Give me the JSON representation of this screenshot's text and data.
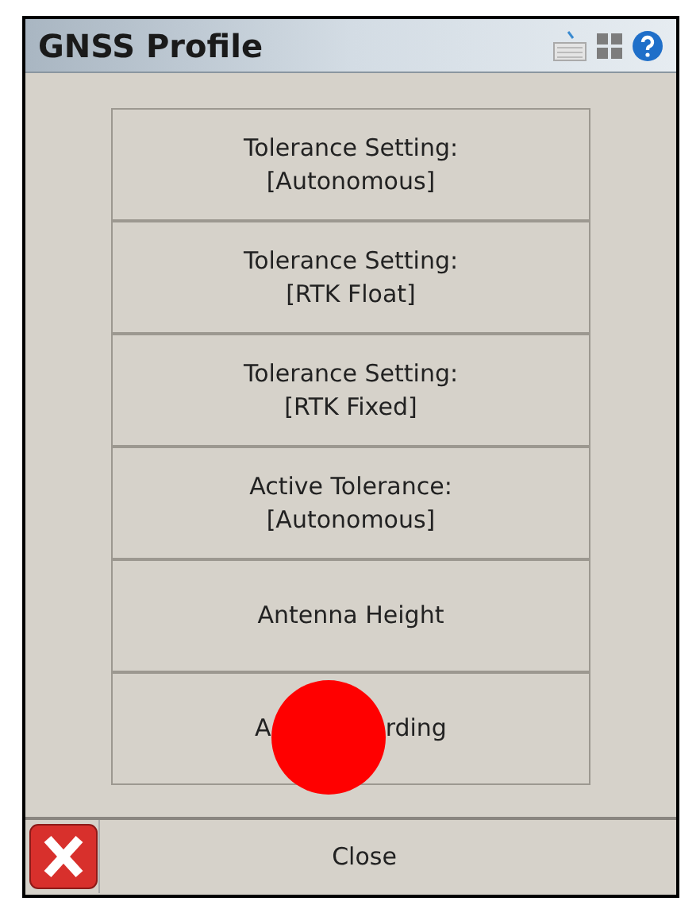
{
  "window": {
    "title": "GNSS Profile"
  },
  "menu_buttons": [
    {
      "kind": "text",
      "lines": [
        "Tolerance Setting:",
        "[Autonomous]"
      ]
    },
    {
      "kind": "text",
      "lines": [
        "Tolerance Setting:",
        "[RTK Float]"
      ]
    },
    {
      "kind": "text",
      "lines": [
        "Tolerance Setting:",
        "[RTK Fixed]"
      ]
    },
    {
      "kind": "text",
      "lines": [
        "Active Tolerance:",
        "[Autonomous]"
      ]
    },
    {
      "kind": "text",
      "lines": [
        "Antenna Height"
      ]
    },
    {
      "kind": "covered",
      "lines": [
        "A",
        "rding"
      ]
    }
  ],
  "footer": {
    "button": "Close"
  }
}
